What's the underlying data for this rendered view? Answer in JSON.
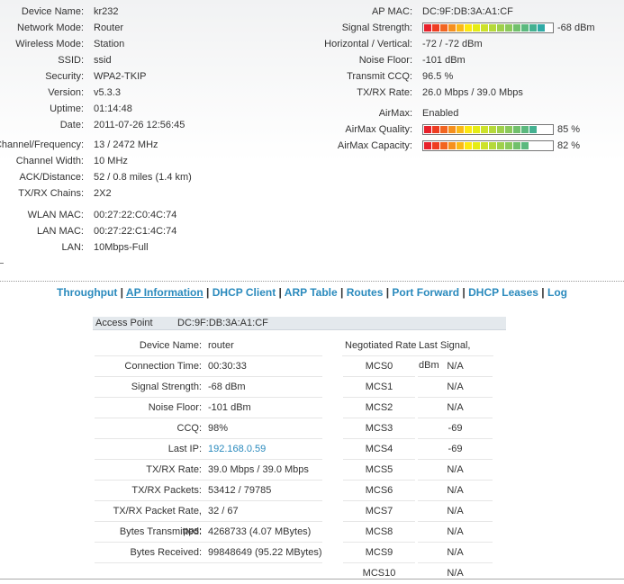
{
  "status_left": [
    {
      "label": "Device Name:",
      "value": "kr232"
    },
    {
      "label": "Network Mode:",
      "value": "Router"
    },
    {
      "label": "Wireless Mode:",
      "value": "Station"
    },
    {
      "label": "SSID:",
      "value": "ssid"
    },
    {
      "label": "Security:",
      "value": "WPA2-TKIP"
    },
    {
      "label": "Version:",
      "value": "v5.3.3"
    },
    {
      "label": "Uptime:",
      "value": "01:14:48"
    },
    {
      "label": "Date:",
      "value": "2011-07-26 12:56:45"
    },
    {
      "label": "Channel/Frequency:",
      "value": "13 / 2472 MHz"
    },
    {
      "label": "Channel Width:",
      "value": "10 MHz"
    },
    {
      "label": "ACK/Distance:",
      "value": "52 / 0.8 miles (1.4 km)"
    },
    {
      "label": "TX/RX Chains:",
      "value": "2X2"
    },
    {
      "label": "WLAN MAC:",
      "value": "00:27:22:C0:4C:74"
    },
    {
      "label": "LAN MAC:",
      "value": "00:27:22:C1:4C:74"
    },
    {
      "label": "LAN:",
      "value": "10Mbps-Full"
    }
  ],
  "status_right": [
    {
      "label": "AP MAC:",
      "value": "DC:9F:DB:3A:A1:CF"
    },
    {
      "label": "Signal Strength:",
      "value": "-68 dBm",
      "bar": 0.93
    },
    {
      "label": "Horizontal / Vertical:",
      "value": "-72 / -72 dBm"
    },
    {
      "label": "Noise Floor:",
      "value": "-101 dBm"
    },
    {
      "label": "Transmit CCQ:",
      "value": "96.5 %"
    },
    {
      "label": "TX/RX Rate:",
      "value": "26.0 Mbps / 39.0 Mbps"
    },
    {
      "label": "AirMax:",
      "value": "Enabled"
    },
    {
      "label": "AirMax Quality:",
      "value": "85 %",
      "bar": 0.85
    },
    {
      "label": "AirMax Capacity:",
      "value": "82 %",
      "bar": 0.82
    }
  ],
  "nav": [
    {
      "label": "Throughput"
    },
    {
      "label": "AP Information",
      "active": true
    },
    {
      "label": "DHCP Client"
    },
    {
      "label": "ARP Table"
    },
    {
      "label": "Routes"
    },
    {
      "label": "Port Forward"
    },
    {
      "label": "DHCP Leases"
    },
    {
      "label": "Log"
    }
  ],
  "ap": {
    "title": "Access Point",
    "mac": "DC:9F:DB:3A:A1:CF"
  },
  "ap_info": [
    {
      "label": "Device Name:",
      "value": "router"
    },
    {
      "label": "Connection Time:",
      "value": "00:30:33"
    },
    {
      "label": "Signal Strength:",
      "value": "-68 dBm"
    },
    {
      "label": "Noise Floor:",
      "value": "-101 dBm"
    },
    {
      "label": "CCQ:",
      "value": "98%"
    },
    {
      "label": "Last IP:",
      "value": "192.168.0.59",
      "link": true
    },
    {
      "label": "TX/RX Rate:",
      "value": "39.0 Mbps / 39.0 Mbps"
    },
    {
      "label": "TX/RX Packets:",
      "value": "53412 / 79785"
    },
    {
      "label": "TX/RX Packet Rate, pps:",
      "value": "32 / 67"
    },
    {
      "label": "Bytes Transmitted:",
      "value": "4268733 (4.07 MBytes)"
    },
    {
      "label": "Bytes Received:",
      "value": "99848649 (95.22 MBytes)"
    }
  ],
  "rates_header": {
    "rate": "Negotiated Rate",
    "signal": "Last Signal, dBm"
  },
  "rates": [
    {
      "rate": "MCS0",
      "signal": "N/A"
    },
    {
      "rate": "MCS1",
      "signal": "N/A"
    },
    {
      "rate": "MCS2",
      "signal": "N/A"
    },
    {
      "rate": "MCS3",
      "signal": "-69"
    },
    {
      "rate": "MCS4",
      "signal": "-69"
    },
    {
      "rate": "MCS5",
      "signal": "N/A"
    },
    {
      "rate": "MCS6",
      "signal": "N/A"
    },
    {
      "rate": "MCS7",
      "signal": "N/A"
    },
    {
      "rate": "MCS8",
      "signal": "N/A"
    },
    {
      "rate": "MCS9",
      "signal": "N/A"
    },
    {
      "rate": "MCS10",
      "signal": "N/A"
    }
  ],
  "colors": {
    "link": "#2a8abd",
    "header_bg": "#e4e9ed"
  }
}
